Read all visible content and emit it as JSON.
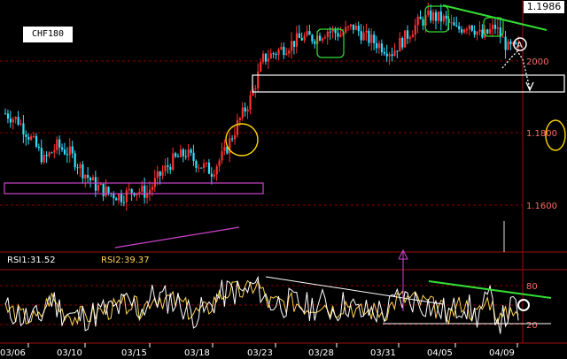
{
  "symbol": "CHF180",
  "last_price": "1.1986",
  "price_ticks": [
    {
      "label": "2000",
      "value": 1.2
    },
    {
      "label": "1.1800",
      "value": 1.18
    },
    {
      "label": "1.1600",
      "value": 1.16
    }
  ],
  "rsi_ticks": [
    {
      "label": "80",
      "value": 80
    },
    {
      "label": "20",
      "value": 20
    }
  ],
  "rsi1_label": "RSI1:31.52",
  "rsi2_label": "RSI2:39.37",
  "date_labels": [
    "03/06",
    "03/10",
    "03/15",
    "03/18",
    "03/23",
    "03/28",
    "03/31",
    "04/05",
    "04/09"
  ],
  "colors": {
    "up": "#ff3030",
    "down": "#30e0ff",
    "grid": "#8b0000",
    "frame": "#a01010",
    "rsi1": "#ffffff",
    "rsi2": "#ffd24d",
    "trend_green": "#33dd33",
    "trend_magenta": "#cc44cc"
  },
  "chart_data": {
    "type": "candlestick",
    "price_ylim": [
      1.147,
      1.2
    ],
    "rsi_ylim": [
      0,
      100
    ],
    "x_count": 200,
    "price_anchors": [
      [
        0,
        1.178
      ],
      [
        5,
        1.176
      ],
      [
        10,
        1.171
      ],
      [
        15,
        1.165
      ],
      [
        20,
        1.169
      ],
      [
        25,
        1.167
      ],
      [
        30,
        1.162
      ],
      [
        35,
        1.158
      ],
      [
        40,
        1.156
      ],
      [
        45,
        1.155
      ],
      [
        50,
        1.157
      ],
      [
        55,
        1.156
      ],
      [
        60,
        1.161
      ],
      [
        65,
        1.165
      ],
      [
        70,
        1.167
      ],
      [
        75,
        1.164
      ],
      [
        80,
        1.162
      ],
      [
        85,
        1.167
      ],
      [
        90,
        1.175
      ],
      [
        95,
        1.182
      ],
      [
        100,
        1.193
      ],
      [
        105,
        1.195
      ],
      [
        110,
        1.197
      ],
      [
        115,
        1.199
      ],
      [
        120,
        1.199
      ],
      [
        125,
        1.201
      ],
      [
        130,
        1.2
      ],
      [
        135,
        1.202
      ],
      [
        140,
        1.199
      ],
      [
        145,
        1.197
      ],
      [
        150,
        1.195
      ],
      [
        155,
        1.199
      ],
      [
        160,
        1.203
      ],
      [
        165,
        1.205
      ],
      [
        170,
        1.204
      ],
      [
        175,
        1.201
      ],
      [
        180,
        1.203
      ],
      [
        185,
        1.199
      ],
      [
        190,
        1.202
      ],
      [
        195,
        1.196
      ],
      [
        199,
        1.196
      ]
    ],
    "rsi1_last": 31.52,
    "rsi2_last": 39.37
  }
}
